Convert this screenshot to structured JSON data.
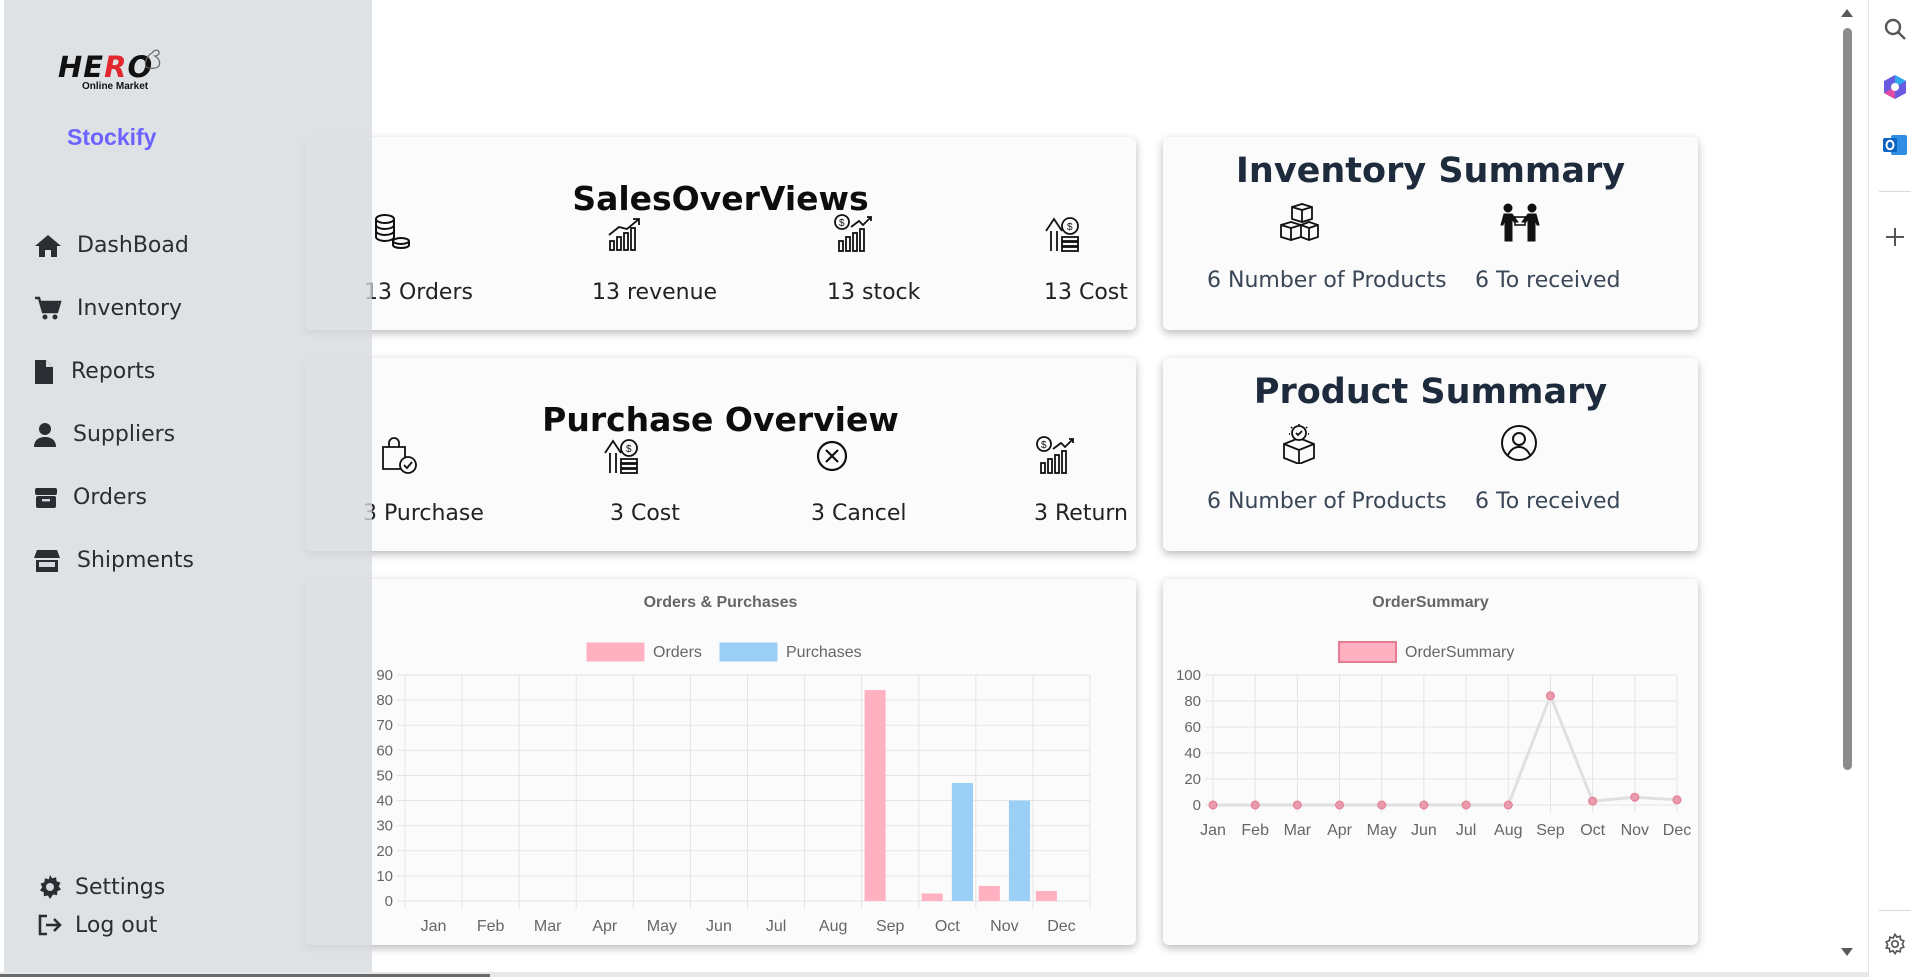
{
  "logo": {
    "word_a": "H",
    "word_b": "E",
    "word_c": "R",
    "word_d": "O",
    "sub": "Online Market"
  },
  "brand": "Stockify",
  "nav": [
    {
      "label": "DashBoad",
      "icon": "home-icon"
    },
    {
      "label": "Inventory",
      "icon": "cart-icon"
    },
    {
      "label": "Reports",
      "icon": "file-icon"
    },
    {
      "label": "Suppliers",
      "icon": "user-icon"
    },
    {
      "label": "Orders",
      "icon": "box-icon"
    },
    {
      "label": "Shipments",
      "icon": "store-icon"
    }
  ],
  "nav_bottom": [
    {
      "label": "Settings",
      "icon": "gear-icon"
    },
    {
      "label": "Log out",
      "icon": "logout-icon"
    }
  ],
  "sales": {
    "title": "SalesOverViews",
    "items": [
      {
        "label": "13 Orders",
        "icon": "coins-stack-icon"
      },
      {
        "label": "13 revenue",
        "icon": "growth-chart-icon"
      },
      {
        "label": "13 stock",
        "icon": "dollar-bars-icon"
      },
      {
        "label": "13 Cost",
        "icon": "cost-up-icon"
      }
    ]
  },
  "purchase": {
    "title": "Purchase Overview",
    "items": [
      {
        "label": "3 Purchase",
        "icon": "shopping-bag-check-icon"
      },
      {
        "label": "3 Cost",
        "icon": "cost-up-icon"
      },
      {
        "label": "3 Cancel",
        "icon": "cancel-circle-icon"
      },
      {
        "label": "3 Return",
        "icon": "dollar-bars-icon"
      }
    ]
  },
  "inventory_summary": {
    "title": "Inventory Summary",
    "items": [
      {
        "label": "6 Number of Products",
        "icon": "boxes-icon"
      },
      {
        "label": "6 To received",
        "icon": "handover-icon"
      }
    ]
  },
  "product_summary": {
    "title": "Product Summary",
    "items": [
      {
        "label": "6 Number of Products",
        "icon": "box-badge-icon"
      },
      {
        "label": "6 To received",
        "icon": "user-circle-icon"
      }
    ]
  },
  "chart_data": [
    {
      "type": "bar",
      "title": "Orders & Purchases",
      "categories": [
        "Jan",
        "Feb",
        "Mar",
        "Apr",
        "May",
        "Jun",
        "Jul",
        "Aug",
        "Sep",
        "Oct",
        "Nov",
        "Dec"
      ],
      "series": [
        {
          "name": "Orders",
          "color": "#ffb1c1",
          "values": [
            0,
            0,
            0,
            0,
            0,
            0,
            0,
            0,
            84,
            3,
            6,
            4
          ]
        },
        {
          "name": "Purchases",
          "color": "#9ad0f5",
          "values": [
            0,
            0,
            0,
            0,
            0,
            0,
            0,
            0,
            0,
            47,
            40,
            0
          ]
        }
      ],
      "ylim": [
        0,
        90
      ],
      "yticks": [
        0,
        10,
        20,
        30,
        40,
        50,
        60,
        70,
        80,
        90
      ],
      "grid": true,
      "legend": "top"
    },
    {
      "type": "line",
      "title": "OrderSummary",
      "categories": [
        "Jan",
        "Feb",
        "Mar",
        "Apr",
        "May",
        "Jun",
        "Jul",
        "Aug",
        "Sep",
        "Oct",
        "Nov",
        "Dec"
      ],
      "series": [
        {
          "name": "OrderSummary",
          "color": "#ffb1c1",
          "line_color": "#e0e0e0",
          "values": [
            0,
            0,
            0,
            0,
            0,
            0,
            0,
            0,
            84,
            3,
            6,
            4
          ]
        }
      ],
      "ylim": [
        0,
        100
      ],
      "yticks": [
        0,
        20,
        40,
        60,
        80,
        100
      ],
      "grid": true,
      "legend": "top"
    }
  ],
  "right_panel": [
    {
      "icon": "search-icon"
    },
    {
      "icon": "copilot-icon"
    },
    {
      "icon": "outlook-icon"
    },
    {
      "icon": "plus-icon"
    },
    {
      "icon": "settings-gear-icon"
    }
  ]
}
